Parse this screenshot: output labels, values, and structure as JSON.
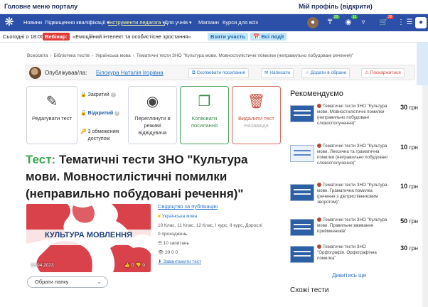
{
  "topbar": {
    "main_menu": "Головне меню порталу",
    "profile": "Мій профіль (відкрити)"
  },
  "nav": {
    "items": [
      "Новини",
      "Підвищення кваліфікації",
      "Інструменти педагога",
      "Для учнів",
      "Магазин",
      "Курси для всіх"
    ],
    "badges": [
      "29",
      "11",
      "28"
    ]
  },
  "webinar": {
    "time": "Сьогодні о 18:00",
    "badge": "Вебінар:",
    "topic": "«Емоційний інтелект та особистісне зростання»",
    "join": "Взяти участь",
    "all": "Всі події"
  },
  "breadcrumbs": [
    "Всеосвіта",
    "Бібліотека тестів",
    "Українська мова",
    "Тематичні тести ЗНО \"Культура мови. Мовностилістичні помилки (неправильно побудовані речення)\""
  ],
  "author": {
    "label": "Опублікував/ла:",
    "name": "Білокура Наталія Ігорівна",
    "actions": [
      "Скопіювати посилання",
      "Написати",
      "Додати в обране",
      "Поскаржитися"
    ]
  },
  "cards": {
    "edit": "Редагувати тест",
    "access": [
      "Закритий",
      "Відкритий",
      "3 обмеженим доступом"
    ],
    "view": "Переглянути в режимі відвідувача",
    "copy": "Копіювати посилання",
    "delete": "Видалити тест",
    "delete_sub": "Назавжди"
  },
  "title": {
    "prefix": "Тест:",
    "text": "Тематичні тести ЗНО \"Культура мови. Мовностилістичні помилки (неправильно побудовані речення)\""
  },
  "cover": {
    "title": "КУЛЬТУРА МОВЛЕННЯ",
    "date": "23.04.2023",
    "likes": "0",
    "dislikes": "0"
  },
  "meta": {
    "certificate": "Свідоцтво за публікацію",
    "language": "Українська мова",
    "grades": "10 Клас, 11 Клас, 12 Клас, І курс, ІІ курс, Дорослі",
    "passes": "0 проходжень",
    "questions": "10 запитань",
    "stats": "20 0 0",
    "download": "Завантажити тест"
  },
  "folder": {
    "label": "Обрати папку"
  },
  "recommend": {
    "title": "Рекомендуємо",
    "items": [
      {
        "text": "Тематичні тести ЗНО \"Культура мови. Мовностилістичні помилки (неправильно побудовані словосполучення)\"",
        "price": "30",
        "currency": "грн"
      },
      {
        "text": "Тематичні тести ЗНО \"Культура мови. Лексична та граматична помилки (неправильно побудовані словосполучення)\"",
        "price": "10",
        "currency": "грн"
      },
      {
        "text": "Тематичні тести ЗНО \"Культура мови. Граматична помилка (речення з дієприслівниковим зворотом)\"",
        "price": "10",
        "currency": "грн"
      },
      {
        "text": "Тематичні тести ЗНО \"Культура мови. Правильне вживання прийменників\"",
        "price": "50",
        "currency": "грн"
      },
      {
        "text": "Тематичні тести ЗНО \"Орфографія. Орфографічна помилка\"",
        "price": "30",
        "currency": "грн"
      }
    ],
    "more": "Дивитись ще"
  },
  "similar": "Схожі тести",
  "colors": {
    "nav": "#2c4fa8",
    "accent_green": "#3aa84e",
    "link": "#2a73c9",
    "danger": "#d9473e"
  }
}
